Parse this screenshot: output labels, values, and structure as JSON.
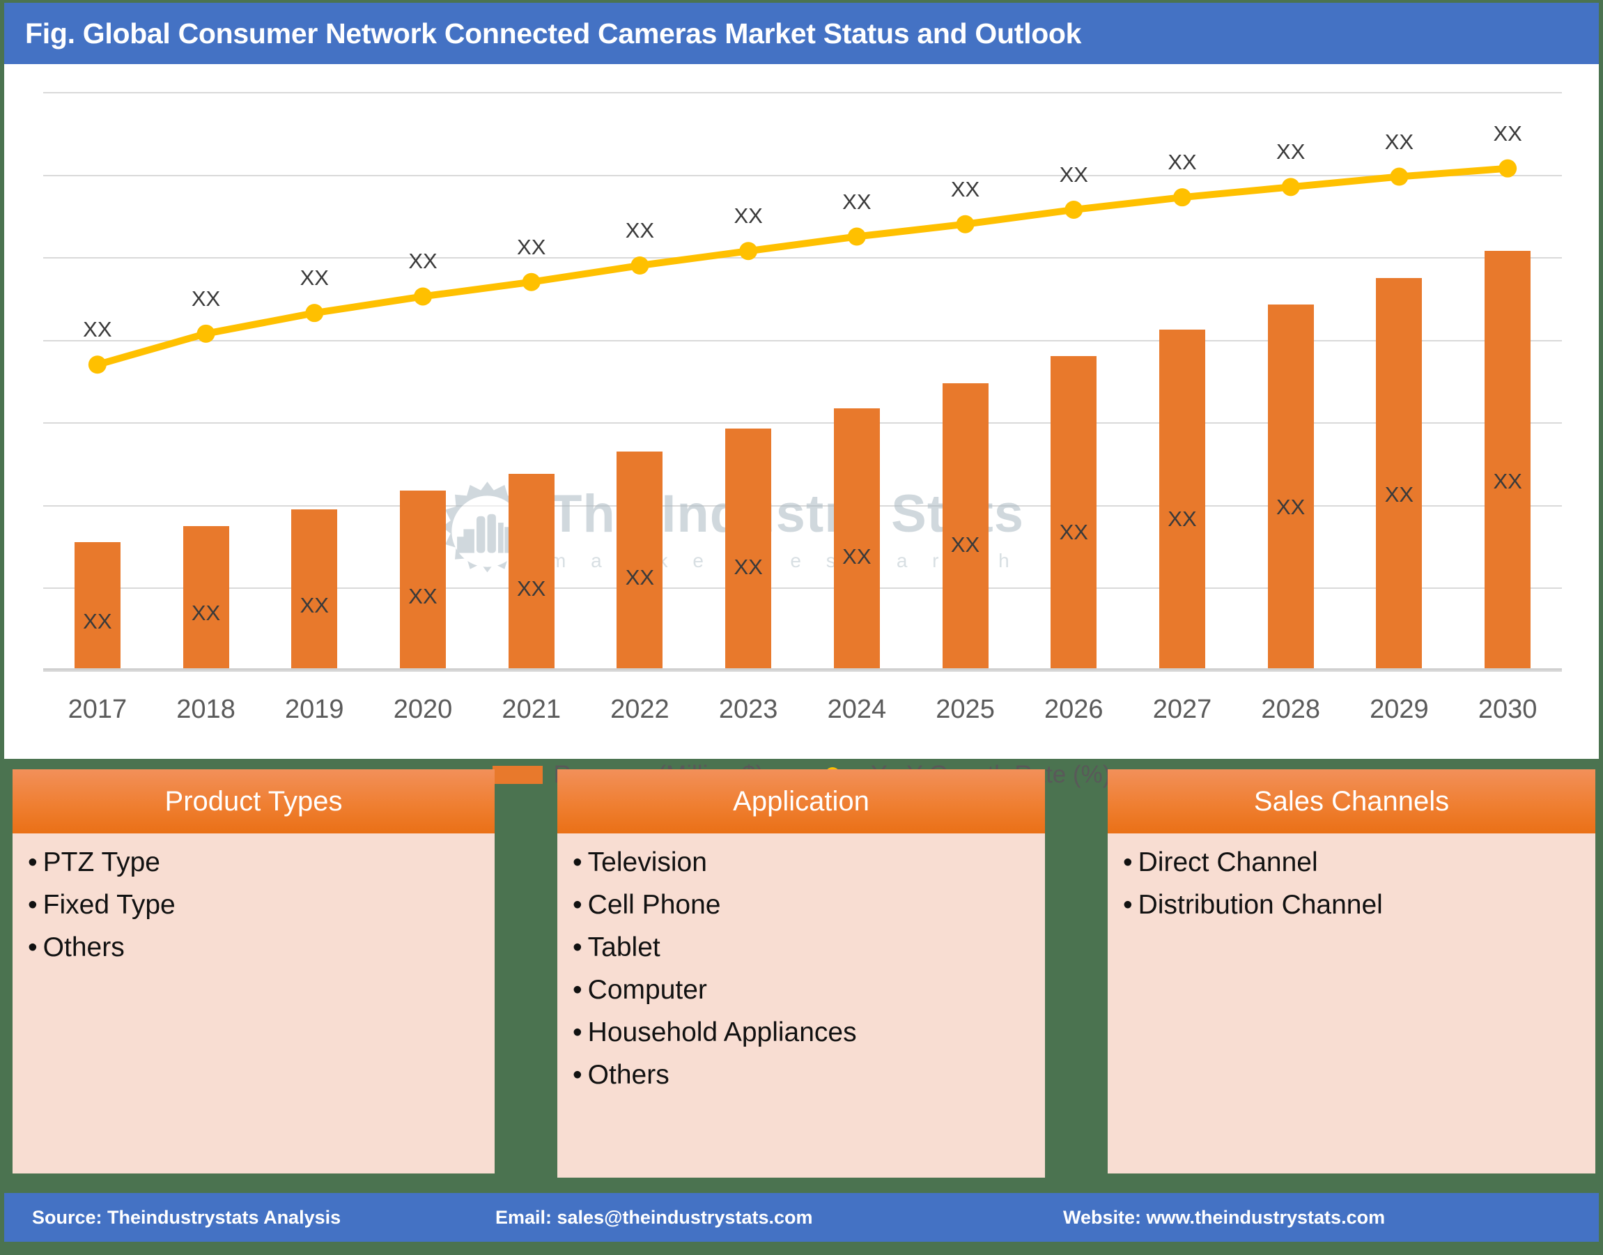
{
  "header": {
    "title": "Fig. Global Consumer Network Connected Cameras Market Status and Outlook",
    "bar_color": "#4472c4"
  },
  "watermark": {
    "title": "The Industry Stats",
    "subtitle": "m a r k e t   r e s e a r c h",
    "logo_icon": "gear-factory-icon"
  },
  "chart_data": {
    "type": "bar",
    "title": "Fig. Global Consumer Network Connected Cameras Market Status and Outlook",
    "xlabel": "",
    "ylabel": "",
    "grid": true,
    "legend_position": "bottom",
    "categories": [
      "2017",
      "2018",
      "2019",
      "2020",
      "2021",
      "2022",
      "2023",
      "2024",
      "2025",
      "2026",
      "2027",
      "2028",
      "2029",
      "2030"
    ],
    "series": [
      {
        "name": "Revenue (Million $)",
        "type": "bar",
        "color": "#e8792c",
        "values": [
          62,
          70,
          78,
          87,
          95,
          106,
          117,
          127,
          139,
          152,
          165,
          177,
          190,
          203
        ],
        "data_labels": [
          "XX",
          "XX",
          "XX",
          "XX",
          "XX",
          "XX",
          "XX",
          "XX",
          "XX",
          "XX",
          "XX",
          "XX",
          "XX",
          "XX"
        ]
      },
      {
        "name": "Y-oY Growth Rate (%)",
        "type": "line",
        "color": "#ffc000",
        "values": [
          148,
          163,
          173,
          181,
          188,
          196,
          203,
          210,
          216,
          223,
          229,
          234,
          239,
          243
        ],
        "data_labels": [
          "XX",
          "XX",
          "XX",
          "XX",
          "XX",
          "XX",
          "XX",
          "XX",
          "XX",
          "XX",
          "XX",
          "XX",
          "XX",
          "XX"
        ]
      }
    ],
    "ylim": [
      0,
      280
    ],
    "gridline_values": [
      280,
      240,
      200,
      160,
      120,
      80,
      40,
      0
    ]
  },
  "legend": [
    {
      "label": "Revenue (Million $)",
      "marker": "bar",
      "color": "#e8792c"
    },
    {
      "label": "Y-oY Growth Rate (%)",
      "marker": "line",
      "color": "#ffc000"
    }
  ],
  "panels": [
    {
      "title": "Product Types",
      "items": [
        "PTZ Type",
        "Fixed Type",
        "Others"
      ]
    },
    {
      "title": "Application",
      "items": [
        "Television",
        "Cell Phone",
        "Tablet",
        "Computer",
        "Household Appliances",
        "Others"
      ]
    },
    {
      "title": "Sales Channels",
      "items": [
        "Direct Channel",
        "Distribution Channel"
      ]
    }
  ],
  "footer": {
    "source": "Source: Theindustrystats Analysis",
    "email": "Email: sales@theindustrystats.com",
    "website": "Website: www.theindustrystats.com",
    "bar_color": "#4472c4"
  },
  "theme": {
    "background": "#4b7350",
    "card_background": "#ffffff",
    "panel_header_gradient_top": "#f2905a",
    "panel_header_gradient_bottom": "#ea7016",
    "panel_body": "#f8ddd2",
    "bar_color": "#e8792c",
    "line_color": "#ffc000",
    "gridline_color": "#d9d9d9"
  },
  "bullet_glyph": "•"
}
